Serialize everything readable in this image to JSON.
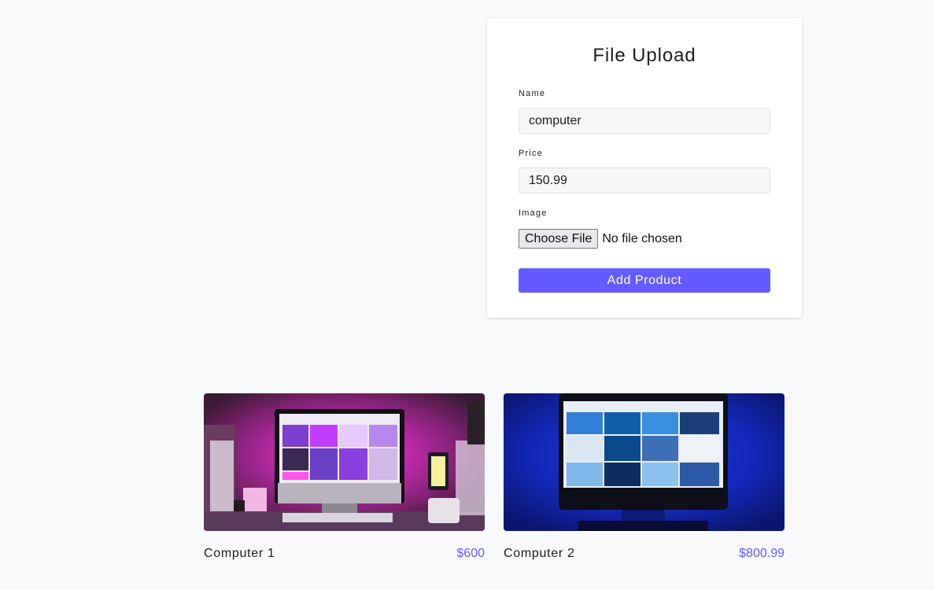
{
  "upload_form": {
    "title": "File Upload",
    "name_label": "Name",
    "name_value": "computer",
    "price_label": "Price",
    "price_value": "150.99",
    "image_label": "Image",
    "file_button_label": "Choose File",
    "file_status": "No file chosen",
    "submit_label": "Add Product"
  },
  "products": [
    {
      "name": "Computer 1",
      "price": "$600",
      "image": "desk-setup-pink-lighting"
    },
    {
      "name": "Computer 2",
      "price": "$800.99",
      "image": "desk-setup-blue-lighting"
    }
  ],
  "colors": {
    "accent": "#635bff",
    "page_background": "#f8f9fb",
    "card_background": "#ffffff"
  }
}
